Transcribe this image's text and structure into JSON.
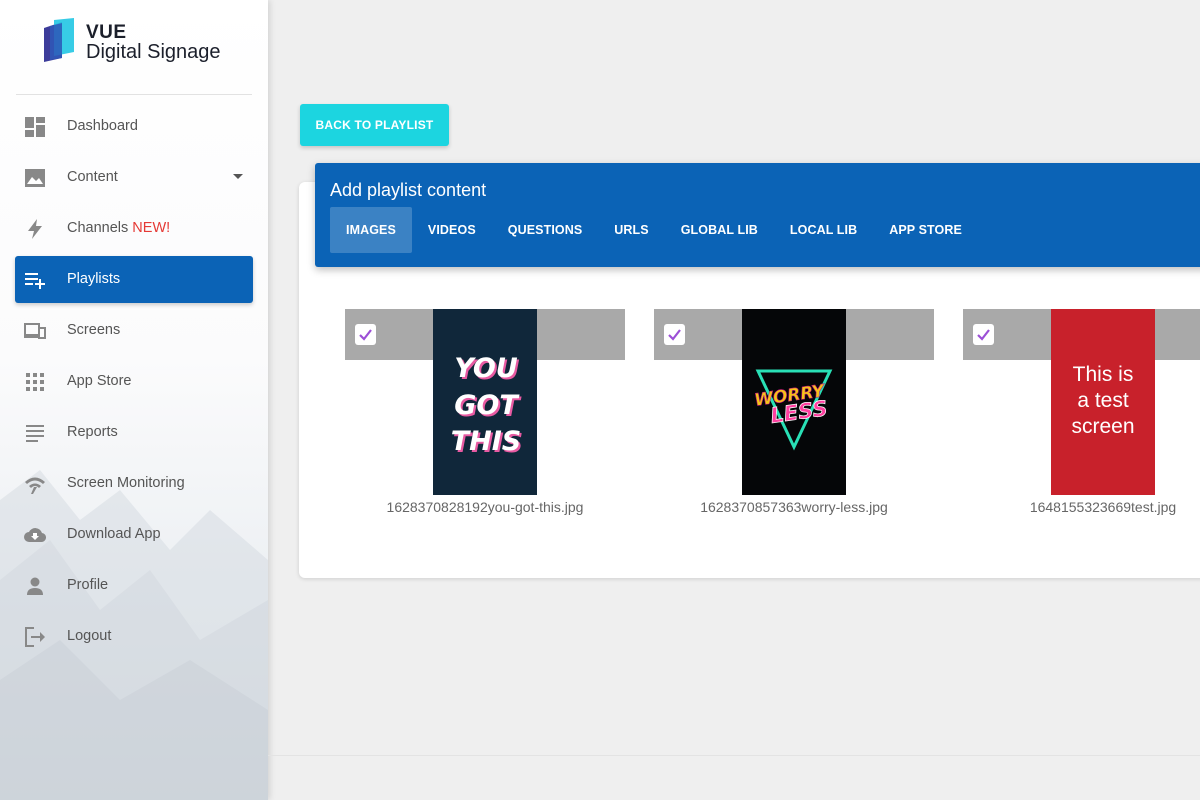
{
  "brand": {
    "line1": "VUE",
    "line2": "Digital Signage"
  },
  "nav": {
    "items": [
      {
        "label": "Dashboard",
        "icon": "dashboard-icon"
      },
      {
        "label": "Content",
        "icon": "image-icon"
      },
      {
        "label": "Channels",
        "badge": "NEW!",
        "icon": "lightning-icon"
      },
      {
        "label": "Playlists",
        "icon": "playlist-add-icon"
      },
      {
        "label": "Screens",
        "icon": "devices-icon"
      },
      {
        "label": "App Store",
        "icon": "apps-grid-icon"
      },
      {
        "label": "Reports",
        "icon": "reports-icon"
      },
      {
        "label": "Screen Monitoring",
        "icon": "signal-icon"
      },
      {
        "label": "Download App",
        "icon": "cloud-download-icon"
      },
      {
        "label": "Profile",
        "icon": "person-icon"
      },
      {
        "label": "Logout",
        "icon": "logout-icon"
      }
    ],
    "active": "Playlists"
  },
  "back_button": "BACK TO PLAYLIST",
  "panel": {
    "title": "Add playlist content",
    "tabs": [
      "IMAGES",
      "VIDEOS",
      "QUESTIONS",
      "URLS",
      "GLOBAL LIB",
      "LOCAL LIB",
      "APP STORE"
    ],
    "active_tab": "IMAGES"
  },
  "items": [
    {
      "filename": "1628370828192you-got-this.jpg",
      "checked": true,
      "thumb_text": [
        "YOU",
        "GOT",
        "THIS"
      ]
    },
    {
      "filename": "1628370857363worry-less.jpg",
      "checked": true,
      "thumb_text": [
        "WORRY",
        "LESS"
      ]
    },
    {
      "filename": "1648155323669test.jpg",
      "checked": true,
      "thumb_text": [
        "This is",
        "a test",
        "screen"
      ]
    }
  ],
  "colors": {
    "primary": "#0b63b6",
    "accent": "#1cd5e0",
    "check": "#9c4fd6",
    "new_badge": "#e53935"
  }
}
